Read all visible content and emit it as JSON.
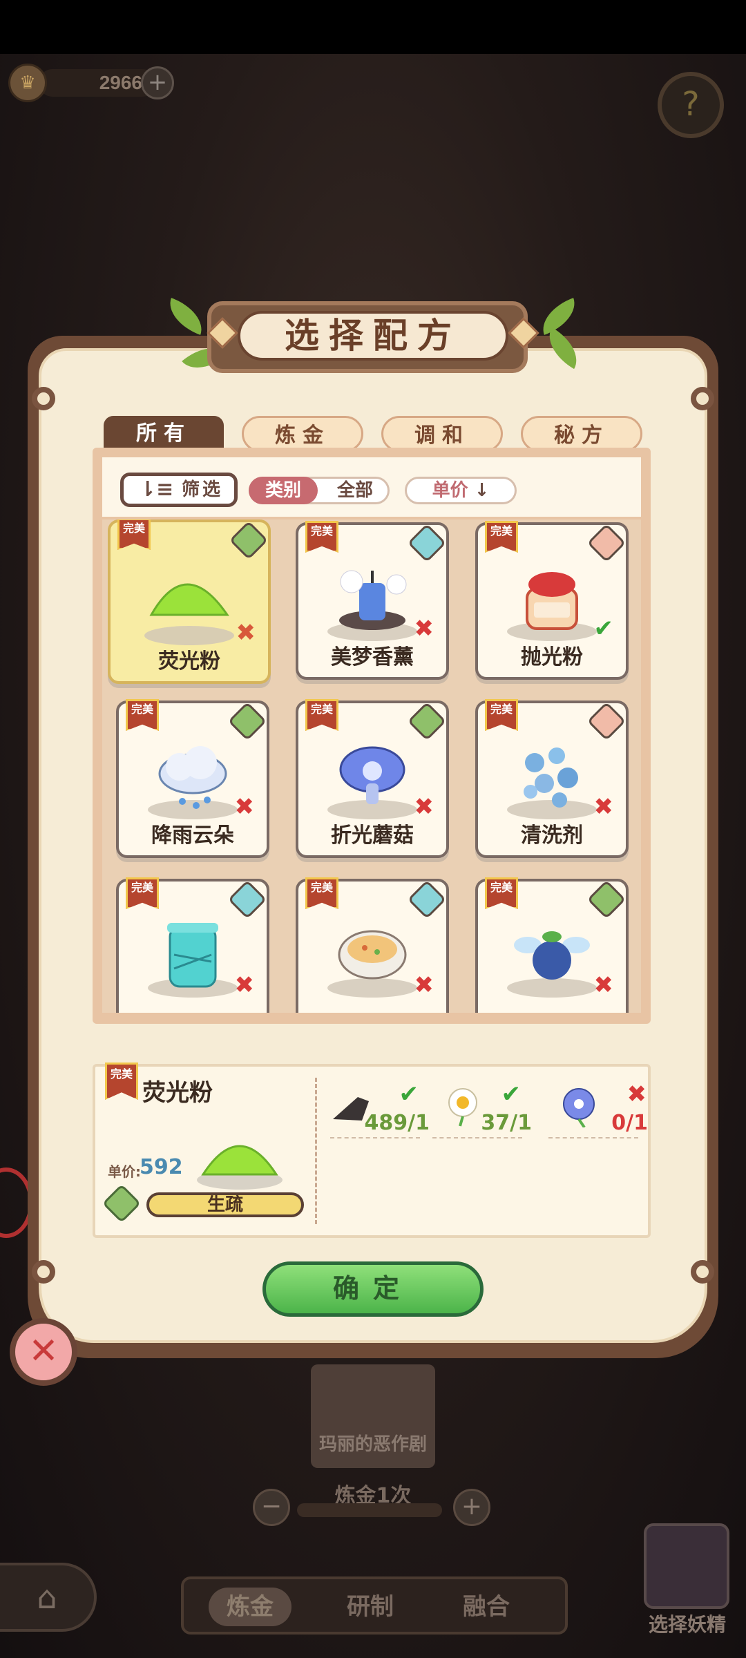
{
  "currency": {
    "value": "2966",
    "plus": "+",
    "icon": "crown-icon"
  },
  "help": {
    "glyph": "?"
  },
  "title": "选择配方",
  "tabs": [
    {
      "label": "所有",
      "active": true
    },
    {
      "label": "炼金",
      "active": false
    },
    {
      "label": "调和",
      "active": false
    },
    {
      "label": "秘方",
      "active": false
    }
  ],
  "filter": {
    "label": "筛选",
    "category_label": "类别",
    "category_value": "全部",
    "price_label": "单价"
  },
  "cards": [
    {
      "name": "荧光粉",
      "ribbon": "完美",
      "badge": "sprout",
      "status": "cross",
      "selected": true
    },
    {
      "name": "美梦香薰",
      "ribbon": "完美",
      "badge": "drop",
      "status": "cross"
    },
    {
      "name": "抛光粉",
      "ribbon": "完美",
      "badge": "mountain",
      "status": "check"
    },
    {
      "name": "降雨云朵",
      "ribbon": "完美",
      "badge": "sprout",
      "status": "cross"
    },
    {
      "name": "折光蘑菇",
      "ribbon": "完美",
      "badge": "sprout",
      "status": "cross"
    },
    {
      "name": "清洗剂",
      "ribbon": "完美",
      "badge": "mountain",
      "status": "cross"
    },
    {
      "name": "",
      "ribbon": "完美",
      "badge": "drop",
      "status": "cross"
    },
    {
      "name": "",
      "ribbon": "完美",
      "badge": "drop",
      "status": "cross"
    },
    {
      "name": "",
      "ribbon": "完美",
      "badge": "sprout",
      "status": "cross"
    }
  ],
  "detail": {
    "ribbon": "完美",
    "name": "荧光粉",
    "price_label": "单价:",
    "price": "592",
    "proficiency": "生疏",
    "ingredients": [
      {
        "count": "489/1",
        "ok": true,
        "icon": "dark-stone-icon"
      },
      {
        "count": "37/1",
        "ok": true,
        "icon": "daisy-icon"
      },
      {
        "count": "0/1",
        "ok": false,
        "icon": "blue-flower-icon"
      }
    ]
  },
  "confirm": "确定",
  "background": {
    "card_label": "玛丽的恶作剧",
    "count_label": "炼金1次",
    "bottom_tabs": [
      "炼金",
      "研制",
      "融合"
    ],
    "fairy_label": "选择妖精"
  },
  "colors": {
    "accent_green": "#4cb44a",
    "check": "#3aa63a",
    "cross": "#d83a3a",
    "ribbon": "#b5452e"
  }
}
